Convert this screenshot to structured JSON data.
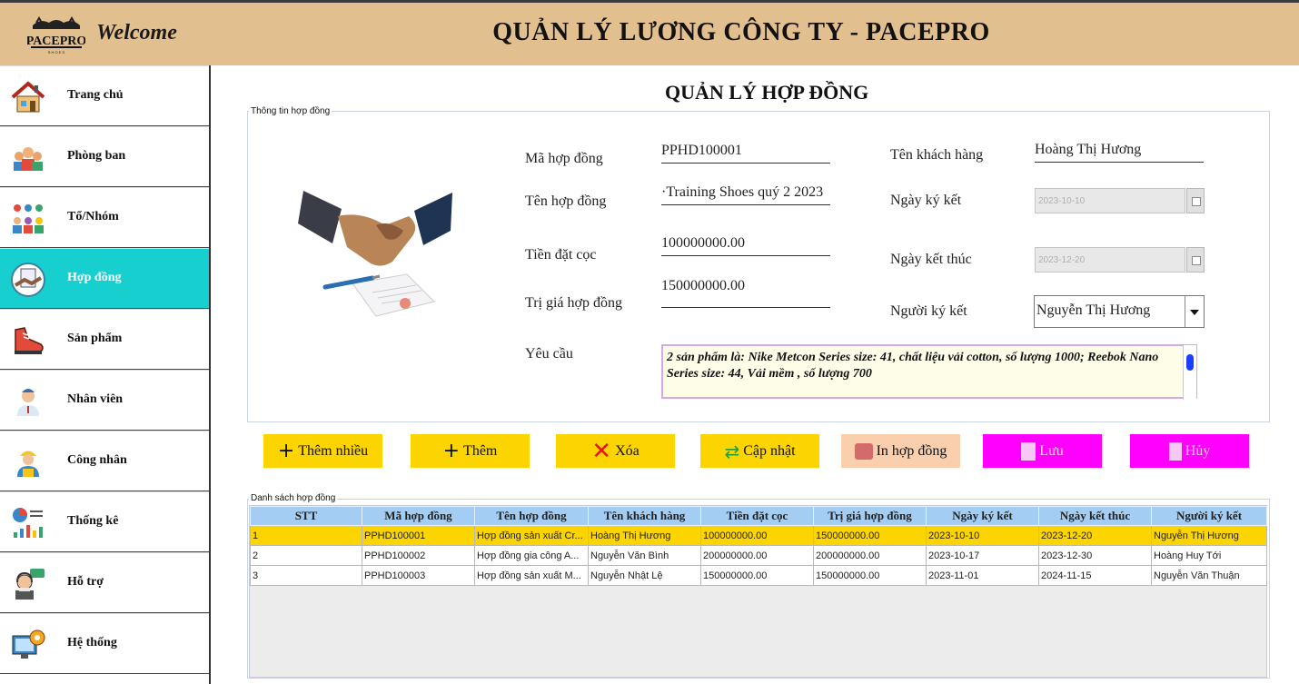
{
  "header": {
    "logo_text": "PACEPRO",
    "welcome": "Welcome",
    "title": "QUẢN LÝ LƯƠNG CÔNG TY - PACEPRO"
  },
  "sidebar": {
    "items": [
      {
        "label": "Trang chủ",
        "icon": "home-icon"
      },
      {
        "label": "Phòng ban",
        "icon": "department-icon"
      },
      {
        "label": "Tổ/Nhóm",
        "icon": "group-icon"
      },
      {
        "label": "Hợp đồng",
        "icon": "contract-icon",
        "active": true
      },
      {
        "label": "Sản phẩm",
        "icon": "shoe-icon"
      },
      {
        "label": "Nhân viên",
        "icon": "employee-icon"
      },
      {
        "label": "Công nhân",
        "icon": "worker-icon"
      },
      {
        "label": "Thống kê",
        "icon": "statistics-icon"
      },
      {
        "label": "Hỗ trợ",
        "icon": "support-icon"
      },
      {
        "label": "Hệ thống",
        "icon": "system-icon"
      }
    ],
    "active_color": "#17cfcf"
  },
  "main": {
    "page_title": "QUẢN LÝ HỢP ĐỒNG",
    "info_group_label": "Thông tin hợp đồng",
    "form": {
      "ma_hd_label": "Mã hợp đồng",
      "ma_hd_value": "PPHD100001",
      "ten_hd_label": "Tên hợp đồng",
      "ten_hd_value": "·Training Shoes quý 2 2023",
      "tien_coc_label": "Tiền đặt cọc",
      "tien_coc_value": "100000000.00",
      "tri_gia_label": "Trị giá hợp đồng",
      "tri_gia_value": "150000000.00",
      "yeu_cau_label": "Yêu cầu",
      "yeu_cau_value": "2 sản phẩm là: Nike Metcon Series size: 41, chất liệu vải cotton, số lượng 1000; Reebok Nano Series size: 44, Vải mềm , số lượng 700",
      "ten_kh_label": "Tên khách hàng",
      "ten_kh_value": "Hoàng Thị Hương",
      "ngay_ky_label": "Ngày ký kết",
      "ngay_ky_value": "2023-10-10",
      "ngay_kt_label": "Ngày kết thúc",
      "ngay_kt_value": "2023-12-20",
      "nguoi_ky_label": "Người ký kết",
      "nguoi_ky_value": "Nguyễn Thị Hương"
    },
    "buttons": {
      "them_nhieu": "Thêm nhiều",
      "them": "Thêm",
      "xoa": "Xóa",
      "cap_nhat": "Cập nhật",
      "in_hd": "In hợp đồng",
      "luu": "Lưu",
      "huy": "Hủy"
    },
    "list_group_label": "Danh sách hợp đồng",
    "table": {
      "headers": [
        "STT",
        "Mã hợp đồng",
        "Tên hợp đồng",
        "Tên khách hàng",
        "Tiền đặt cọc",
        "Trị giá hợp đồng",
        "Ngày ký kết",
        "Ngày kết thúc",
        "Người ký kết"
      ],
      "rows": [
        [
          "1",
          "PPHD100001",
          "Hợp đồng sản xuất Cr...",
          "Hoàng Thị Hương",
          "100000000.00",
          "150000000.00",
          "2023-10-10",
          "2023-12-20",
          "Nguyễn Thị Hương"
        ],
        [
          "2",
          "PPHD100002",
          "Hợp đồng gia công A...",
          "Nguyễn Văn Bình",
          "200000000.00",
          "200000000.00",
          "2023-10-17",
          "2023-12-30",
          "Hoàng Huy Tới"
        ],
        [
          "3",
          "PPHD100003",
          "Hợp đồng sản xuất M...",
          "Nguyễn Nhật Lệ",
          "150000000.00",
          "150000000.00",
          "2023-11-01",
          "2024-11-15",
          "Nguyễn Văn Thuận"
        ]
      ],
      "selected_row": 0
    }
  },
  "colors": {
    "header_bg": "#e2bf8e",
    "button_yellow": "#fcd500",
    "button_peach": "#f9cfae",
    "button_magenta": "#ff00ff",
    "table_header": "#a3cdf2",
    "selected_row": "#fcd500"
  }
}
